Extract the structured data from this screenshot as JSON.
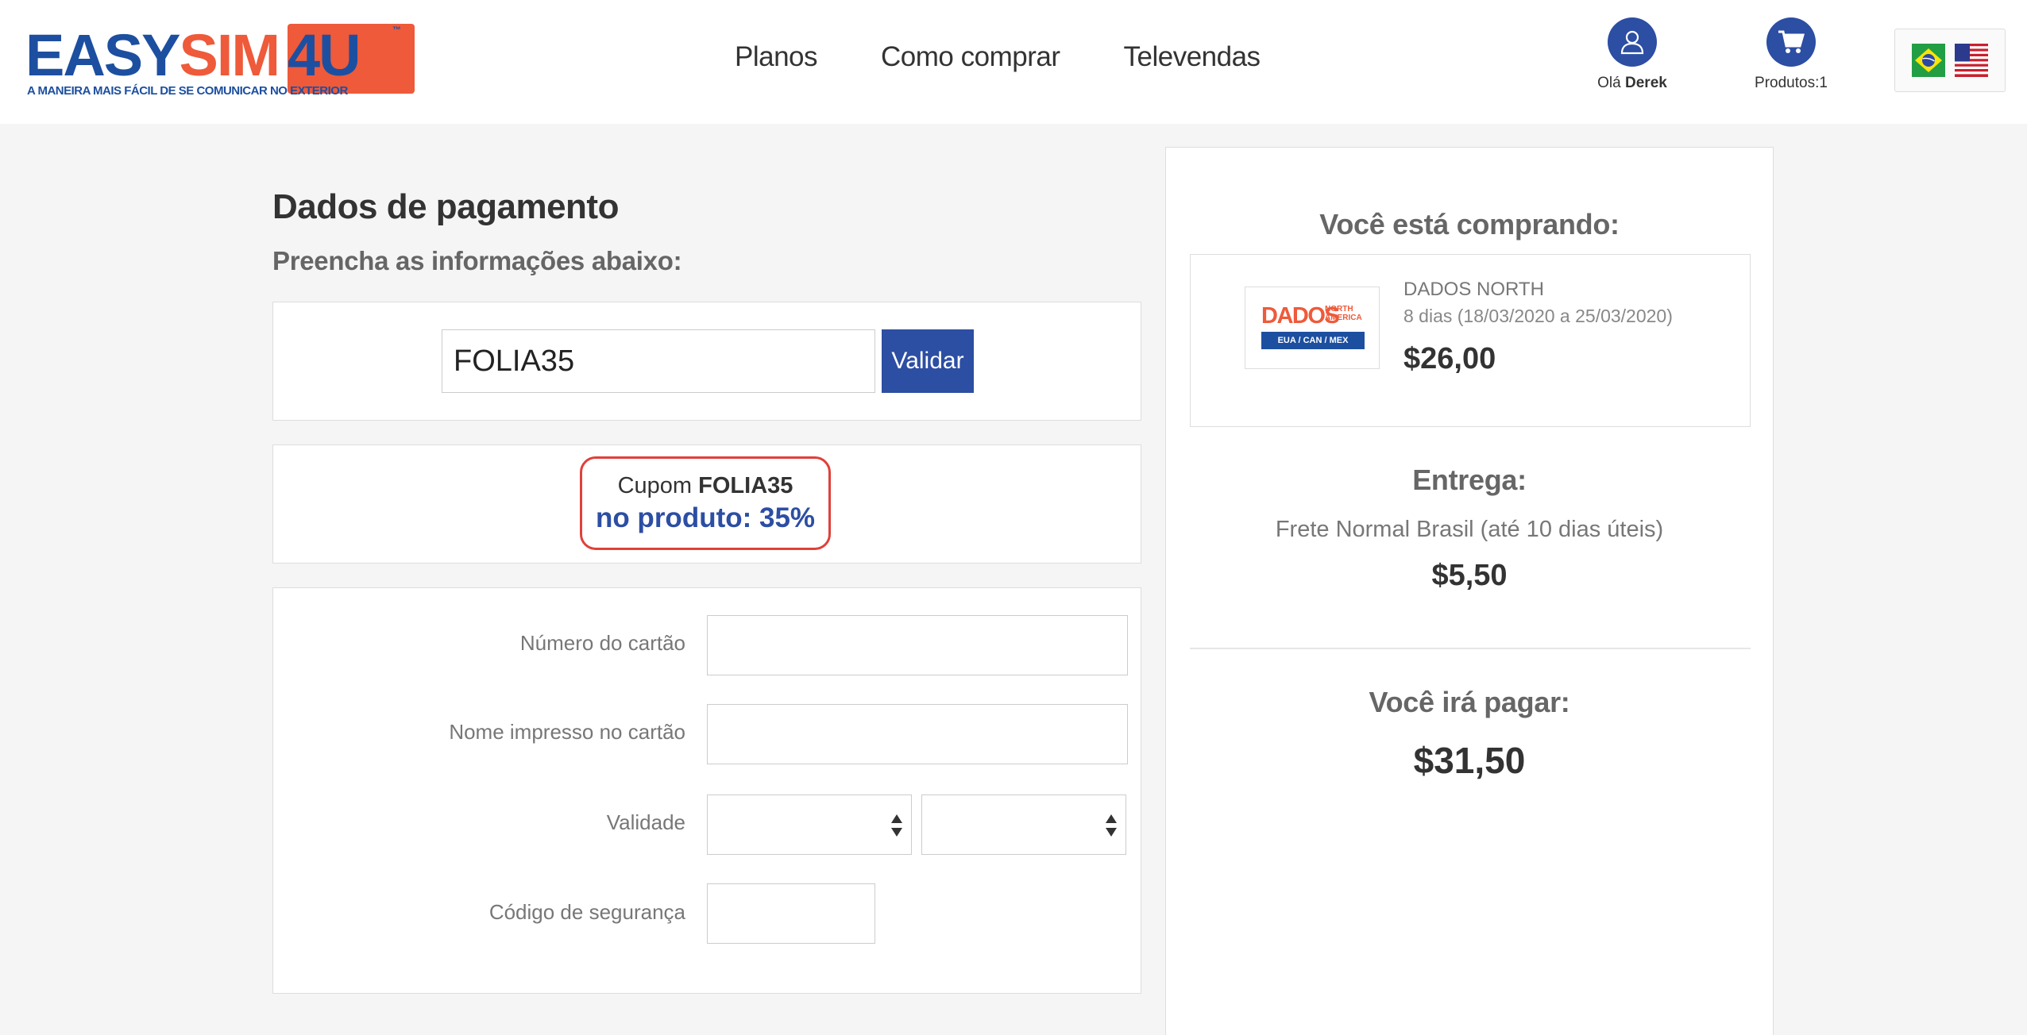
{
  "brand": {
    "logo_easy": "EASY",
    "logo_sim": "SIM",
    "logo_4u": "4U",
    "logo_tm": "™",
    "tagline": "A MANEIRA MAIS FÁCIL DE SE COMUNICAR NO EXTERIOR",
    "colors": {
      "primary_blue": "#2c4ea3",
      "brand_orange": "#ee5a3a",
      "alert_red": "#e0403a"
    }
  },
  "nav": {
    "items": [
      {
        "label": "Planos"
      },
      {
        "label": "Como comprar"
      },
      {
        "label": "Televendas"
      }
    ]
  },
  "user": {
    "icon": "user-icon",
    "greeting": "Olá",
    "name": "Derek"
  },
  "cart": {
    "icon": "cart-icon",
    "label": "Produtos:1"
  },
  "languages": [
    {
      "icon": "brazil-flag-icon"
    },
    {
      "icon": "usa-flag-icon"
    }
  ],
  "payment": {
    "title": "Dados de pagamento",
    "subtitle": "Preencha as informações abaixo:"
  },
  "coupon": {
    "value": "FOLIA35",
    "placeholder": "",
    "validate_label": "Validar"
  },
  "discount": {
    "prefix": "Cupom",
    "code": "FOLIA35",
    "detail": "no produto: 35%"
  },
  "card_form": {
    "card_number_label": "Número do cartão",
    "card_name_label": "Nome impresso no cartão",
    "expiry_label": "Validade",
    "cvv_label": "Código de segurança",
    "card_number_value": "",
    "card_name_value": "",
    "expiry_month_value": "",
    "expiry_year_value": "",
    "cvv_value": ""
  },
  "summary": {
    "buying_heading": "Você está comprando:",
    "product": {
      "thumb_dados": "DADOS",
      "thumb_north": "NORTH",
      "thumb_america": "AMERICA",
      "thumb_region": "EUA / CAN / MEX",
      "name": "DADOS NORTH",
      "dates": "8 dias (18/03/2020 a 25/03/2020)",
      "price": "$26,00"
    },
    "delivery_heading": "Entrega:",
    "delivery_method": "Frete Normal Brasil (até 10 dias úteis)",
    "delivery_price": "$5,50",
    "total_heading": "Você irá pagar:",
    "total_price": "$31,50"
  }
}
